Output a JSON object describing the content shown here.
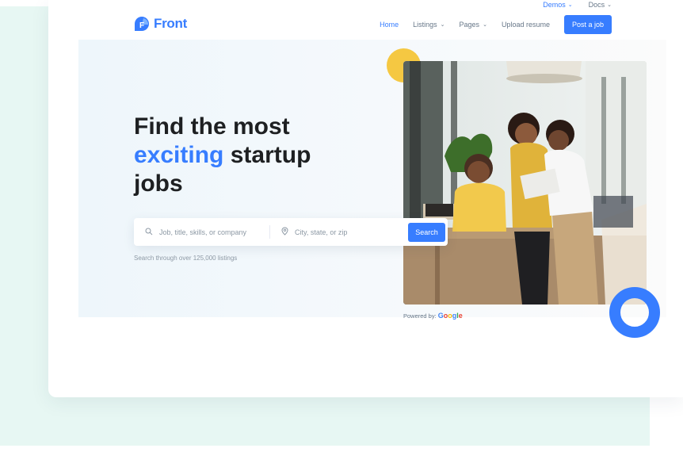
{
  "topbar": {
    "demos_label": "Demos",
    "docs_label": "Docs"
  },
  "brand": {
    "name": "Front",
    "logo_letter": "F",
    "accent_color": "#377dff"
  },
  "nav": {
    "items": [
      {
        "label": "Home",
        "active": true,
        "dropdown": false
      },
      {
        "label": "Listings",
        "active": false,
        "dropdown": true
      },
      {
        "label": "Pages",
        "active": false,
        "dropdown": true
      },
      {
        "label": "Upload resume",
        "active": false,
        "dropdown": false
      }
    ],
    "cta_label": "Post a job"
  },
  "hero": {
    "headline_line1": "Find the most",
    "headline_highlight": "exciting",
    "headline_line2_rest": "startup",
    "headline_line3": "jobs",
    "search": {
      "job_placeholder": "Job, title, skills, or company",
      "location_placeholder": "City, state, or zip",
      "button_label": "Search"
    },
    "hint": "Search through over 125,000 listings",
    "powered_by": "Powered by:",
    "powered_brand": "Google"
  },
  "icons": {
    "search": "search-icon",
    "location": "map-pin-icon",
    "chevron": "chevron-down-icon"
  }
}
